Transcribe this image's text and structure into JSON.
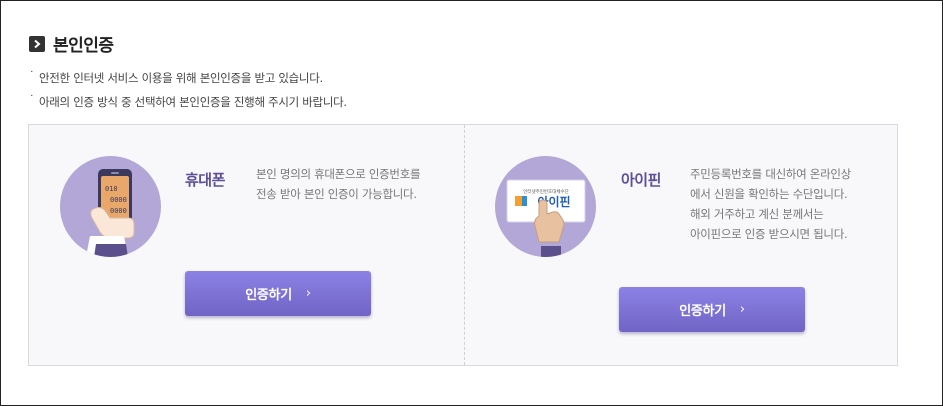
{
  "section": {
    "title": "본인인증",
    "notes": [
      "안전한 인터넷 서비스 이용을 위해 본인인증을 받고 있습니다.",
      "아래의 인증 방식 중 선택하여 본인인증을 진행해 주시기 바랍니다."
    ]
  },
  "methods": [
    {
      "name": "휴대폰",
      "icon": "phone-icon",
      "phone_digits": [
        "010",
        "0000",
        "0000"
      ],
      "desc": [
        "본인 명의의 휴대폰으로 인증번호를",
        "전송 받아 본인 인증이 가능합니다."
      ],
      "button_label": "인증하기",
      "button_chevron": "›"
    },
    {
      "name": "아이핀",
      "icon": "ipin-card-icon",
      "card_caption": "인터넷주민번호대체수단",
      "card_logo": "아이핀",
      "desc": [
        "주민등록번호를 대신하여 온라인상",
        "에서 신원을 확인하는 수단입니다.",
        "해외 거주하고 계신 분께서는",
        "아이핀으로 인증 받으시면 됩니다."
      ],
      "button_label": "인증하기",
      "button_chevron": "›"
    }
  ],
  "colors": {
    "accent_purple": "#5e4f98",
    "button": "#7c70d6",
    "circle": "#b2a7d6",
    "panel_bg": "#f8f8fa"
  }
}
